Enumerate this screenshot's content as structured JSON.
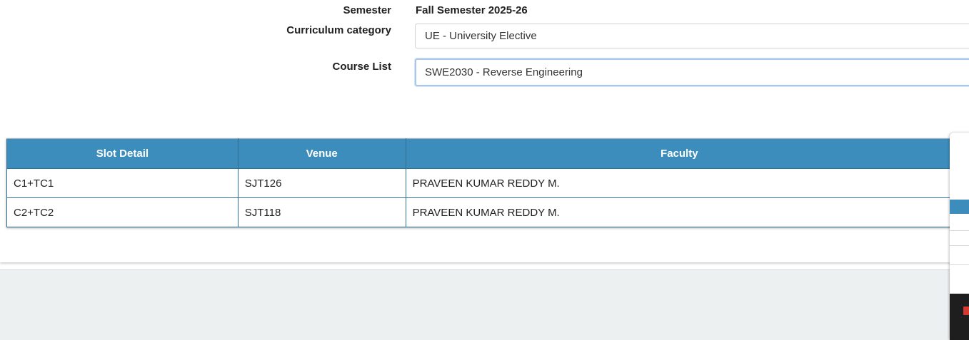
{
  "form": {
    "semester_label": "Semester",
    "semester_value": "Fall Semester 2025-26",
    "curriculum_label": "Curriculum category",
    "curriculum_value": "UE - University Elective",
    "course_label": "Course List",
    "course_value": "SWE2030 - Reverse Engineering"
  },
  "table": {
    "headers": [
      "Slot Detail",
      "Venue",
      "Faculty"
    ],
    "rows": [
      {
        "slot": "C1+TC1",
        "venue": "SJT126",
        "faculty": "PRAVEEN KUMAR REDDY M."
      },
      {
        "slot": "C2+TC2",
        "venue": "SJT118",
        "faculty": "PRAVEEN KUMAR REDDY M."
      }
    ]
  },
  "colors": {
    "header_bg": "#3c8dbc",
    "footer_bg": "#ecf0f1"
  }
}
